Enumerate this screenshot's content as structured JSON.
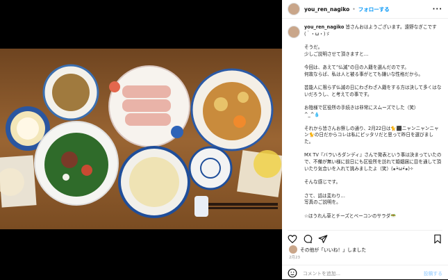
{
  "post": {
    "username": "you_ren_nagiko",
    "follow_label": "フォローする",
    "caption": {
      "first_line": "皆さんおはようございます。遠野なぎこです(｀・ω・)ゞ",
      "paragraphs": [
        "そうだ。\n少しご説明させて頂きますと…",
        "今回は、あえて”仏滅”の日の入籍を選んだのです。\n何故ならば、私は人と被る事がとても嫌いな性格だから。",
        "芸能人に限らず仏滅の日にわざわざ入籍をする方は決して多くはないだろうし、と考えての事です。",
        "お陰様で区役所の手続きは非常にスムーズでした（笑）\n^_^💧",
        "それから皆さんお察しの通り、2月22日は🐈⬛ニャンニャンニャン🐈の日だからコレは私にピッタリだと思って昨日を選びました。",
        "MX TV『バラいろダンディ』さんで発表という事は決まっていたので、不備が無い様に前日にも区役所を訪れて婚姻届に目を通して頂いたり気合いを入れて挑みましたよ（笑）(๑•̀ω•́๑)✧",
        "そんな感じです。",
        "さて、話は変わり…\n写真のご説明を。",
        "☆ほうれん草とチーズとベーコンのサラダ🥗"
      ]
    },
    "likes_text": "その他が「いいね！」しました",
    "date": "2月23",
    "comment_placeholder": "コメントを追加...",
    "post_label": "投稿する"
  },
  "icons": {
    "more": "more-icon",
    "like": "heart-icon",
    "comment": "comment-icon",
    "share": "send-icon",
    "save": "bookmark-icon",
    "emoji": "emoji-icon"
  },
  "colors": {
    "link": "#0095f6",
    "table": "#8a5a2b"
  }
}
